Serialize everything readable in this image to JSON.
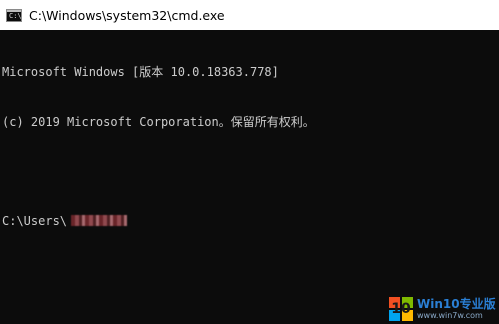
{
  "window": {
    "title": "C:\\Windows\\system32\\cmd.exe",
    "icon": "console-icon",
    "icon_prompt": "C:\\"
  },
  "console": {
    "lines": [
      "Microsoft Windows [版本 10.0.18363.778]",
      "(c) 2019 Microsoft Corporation。保留所有权利。",
      "",
      "C:\\Users\\"
    ],
    "text_color": "#cccccc",
    "background_color": "#0c0c0c"
  },
  "watermark": {
    "logo_number": "10",
    "title": "Win10专业版",
    "url": "www.win7w.com",
    "title_color": "#2a7fd4"
  }
}
